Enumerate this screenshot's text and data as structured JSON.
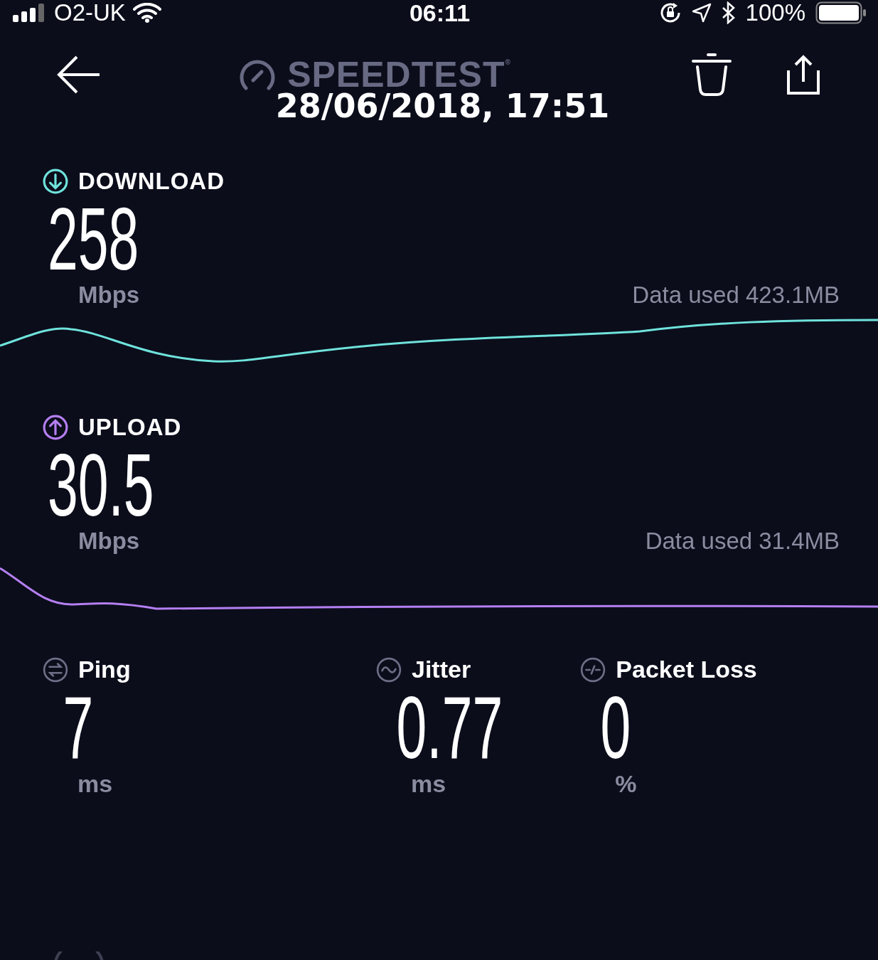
{
  "status_bar": {
    "carrier": "O2-UK",
    "time": "06:11",
    "battery": "100%"
  },
  "header": {
    "logo": "SPEEDTEST$^{®}$"
  },
  "date": "28/06/2018, 17:51",
  "speeds": [
    {
      "kind": "download",
      "label": "DOWNLOAD",
      "value": "258",
      "unit": "Mbps",
      "data_used": "Data used 423.1MB",
      "color": "#6fe3dc"
    },
    {
      "kind": "upload",
      "label": "UPLOAD",
      "value": "30.5",
      "unit": "Mbps",
      "data_used": "Data used 31.4MB",
      "color": "#b57ff2"
    }
  ],
  "metrics": [
    {
      "kind": "ping",
      "label": "Ping",
      "value": "7",
      "unit": "ms"
    },
    {
      "kind": "jitter",
      "label": "Jitter",
      "value": "0.77",
      "unit": "ms"
    },
    {
      "kind": "packet_loss",
      "label": "Packet Loss",
      "value": "0",
      "unit": "%"
    }
  ]
}
